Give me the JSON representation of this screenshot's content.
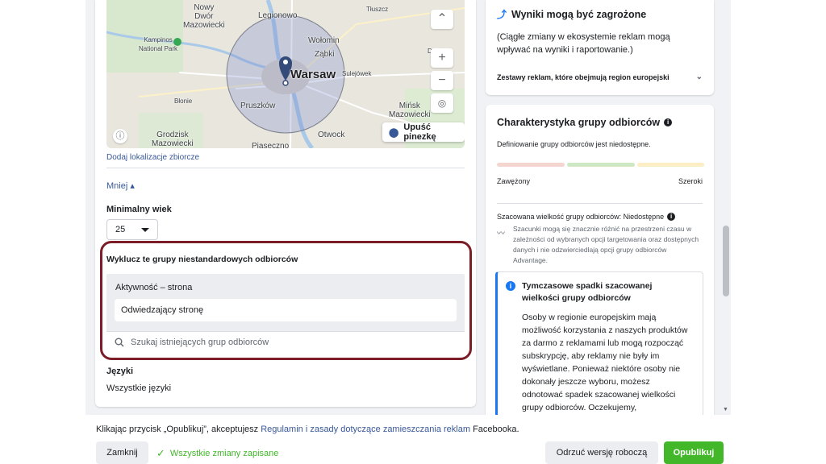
{
  "map": {
    "labels": [
      "Nowy Dwór Mazowiecki",
      "Legionowo",
      "Tłuszcz",
      "Kampinos National Park",
      "Wołomin",
      "Ząbki",
      "Dobre",
      "Sulejówek",
      "Warsaw",
      "Pruszków",
      "Błonie",
      "Mińsk Mazowiecki",
      "Grodzisk Mazowiecki",
      "Otwock",
      "Piaseczno"
    ],
    "drop_pin_label": "Upuść pinezkę"
  },
  "location": {
    "add_bulk_link": "Dodaj lokalizacje zbiorcze",
    "less_link": "Mniej ▴"
  },
  "age": {
    "label": "Minimalny wiek",
    "value": "25"
  },
  "exclude": {
    "title": "Wyklucz te grupy niestandardowych odbiorców",
    "group_label": "Aktywność – strona",
    "chip": "Odwiedzający stronę",
    "search_placeholder": "Szukaj istniejących grup odbiorców"
  },
  "languages": {
    "label": "Języki",
    "value": "Wszystkie języki"
  },
  "warning": {
    "title": "Wyniki mogą być zagrożone",
    "description": "(Ciągłe zmiany w ekosystemie reklam mogą wpływać na wyniki i raportowanie.)",
    "accordion": "Zestawy reklam, które obejmują region europejski"
  },
  "audience": {
    "title": "Charakterystyka grupy odbiorców",
    "subtitle": "Definiowanie grupy odbiorców jest niedostępne.",
    "narrow": "Zawężony",
    "broad": "Szeroki",
    "estimate_title": "Szacowana wielkość grupy odbiorców: Niedostępne",
    "estimate_body": "Szacunki mogą się znacznie różnić na przestrzeni czasu w zależności od wybranych opcji targetowania oraz dostępnych danych i nie odzwierciedlają opcji grupy odbiorców Advantage.",
    "meter_colors": [
      "#f5d5cf",
      "#cfe8c4",
      "#fbeec4"
    ]
  },
  "notice": {
    "title": "Tymczasowe spadki szacowanej wielkości grupy odbiorców",
    "body": "Osoby w regionie europejskim mają możliwość korzystania z naszych produktów za darmo z reklamami lub mogą rozpocząć subskrypcję, aby reklamy nie były im wyświetlane. Ponieważ niektóre osoby nie dokonały jeszcze wyboru, możesz odnotować spadek szacowanej wielkości grupy odbiorców. Oczekujemy,"
  },
  "footer": {
    "text_before": "Klikając przycisk „Opublikuj”, akceptujesz ",
    "link": "Regulamin i zasady dotyczące zamieszczania reklam",
    "text_after": " Facebooka.",
    "close_button": "Zamknij",
    "saved_status": "Wszystkie zmiany zapisane",
    "discard_button": "Odrzuć wersję roboczą",
    "publish_button": "Opublikuj"
  },
  "colors": {
    "accent_link": "#385898",
    "publish_green": "#42b72a",
    "highlight_border": "#7c1d28",
    "info_blue": "#1877f2"
  }
}
